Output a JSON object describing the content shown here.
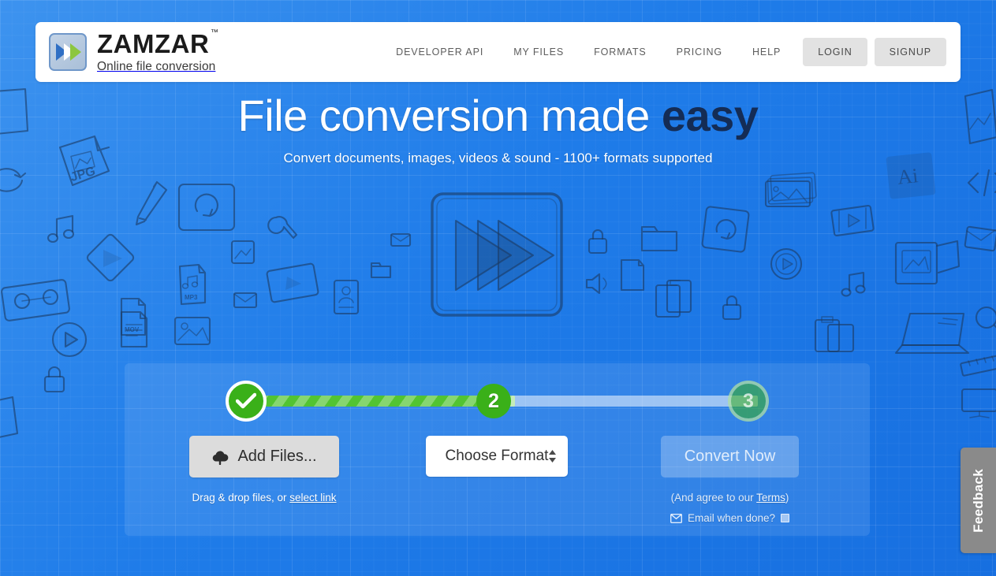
{
  "header": {
    "logo": {
      "word": "ZAMZAR",
      "trademark": "™",
      "tagline": "Online file conversion",
      "mark_icon": "double-chevron-play-icon"
    },
    "nav_links": [
      {
        "label": "DEVELOPER API",
        "name": "nav-developer-api"
      },
      {
        "label": "MY FILES",
        "name": "nav-my-files"
      },
      {
        "label": "FORMATS",
        "name": "nav-formats"
      },
      {
        "label": "PRICING",
        "name": "nav-pricing"
      },
      {
        "label": "HELP",
        "name": "nav-help"
      }
    ],
    "login_label": "LOGIN",
    "signup_label": "SIGNUP"
  },
  "hero": {
    "headline_plain": "File conversion made ",
    "headline_strong": "easy",
    "subline": "Convert documents, images, videos & sound - 1100+ formats supported"
  },
  "widget": {
    "steps": [
      {
        "label": "✓",
        "state": "complete"
      },
      {
        "label": "2",
        "state": "active"
      },
      {
        "label": "3",
        "state": "pending"
      }
    ],
    "step1": {
      "button_label": "Add Files...",
      "button_icon": "cloud-upload-icon",
      "hint_prefix": "Drag & drop files, or ",
      "hint_link": "select link"
    },
    "step2": {
      "select_value": "Choose Format",
      "select_icon": "updown-arrows-icon"
    },
    "step3": {
      "button_label": "Convert Now",
      "terms_prefix": "(And agree to our ",
      "terms_link": "Terms",
      "terms_suffix": ")",
      "email_icon": "envelope-icon",
      "email_label": "Email when done?",
      "email_checked": false
    }
  },
  "feedback": {
    "label": "Feedback"
  },
  "colors": {
    "background_blue": "#1f7ce9",
    "accent_green": "#3ab019",
    "progress_green": "#52c432",
    "headline_strong": "#142c55",
    "button_grey": "#dcdcdc",
    "feedback_grey": "#8a8a8a"
  }
}
